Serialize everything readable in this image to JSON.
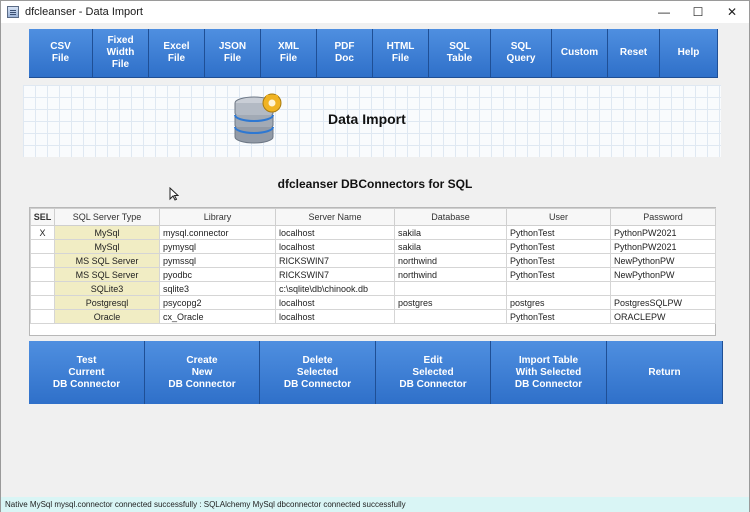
{
  "window": {
    "title": "dfcleanser - Data Import",
    "controls": {
      "minimize": "—",
      "maximize": "☐",
      "close": "✕"
    }
  },
  "toolbar": {
    "buttons": [
      "CSV\nFile",
      "Fixed\nWidth\nFile",
      "Excel\nFile",
      "JSON\nFile",
      "XML\nFile",
      "PDF\nDoc",
      "HTML\nFile",
      "SQL\nTable",
      "SQL\nQuery",
      "Custom",
      "Reset",
      "Help"
    ]
  },
  "banner": {
    "title": "Data Import",
    "logo_icon": "database-gear-icon"
  },
  "section": {
    "title": "dfcleanser DBConnectors for SQL"
  },
  "table": {
    "headers": [
      "SEL",
      "SQL Server Type",
      "Library",
      "Server Name",
      "Database",
      "User",
      "Password"
    ],
    "rows": [
      [
        "X",
        "MySql",
        "mysql.connector",
        "localhost",
        "sakila",
        "PythonTest",
        "PythonPW2021"
      ],
      [
        "",
        "MySql",
        "pymysql",
        "localhost",
        "sakila",
        "PythonTest",
        "PythonPW2021"
      ],
      [
        "",
        "MS SQL Server",
        "pymssql",
        "RICKSWIN7",
        "northwind",
        "PythonTest",
        "NewPythonPW"
      ],
      [
        "",
        "MS SQL Server",
        "pyodbc",
        "RICKSWIN7",
        "northwind",
        "PythonTest",
        "NewPythonPW"
      ],
      [
        "",
        "SQLite3",
        "sqlite3",
        "c:\\sqlite\\db\\chinook.db",
        "",
        "",
        ""
      ],
      [
        "",
        "Postgresql",
        "psycopg2",
        "localhost",
        "postgres",
        "postgres",
        "PostgresSQLPW"
      ],
      [
        "",
        "Oracle",
        "cx_Oracle",
        "localhost",
        "",
        "PythonTest",
        "ORACLEPW"
      ]
    ]
  },
  "actions": {
    "buttons": [
      "Test\nCurrent\nDB Connector",
      "Create\nNew\nDB Connector",
      "Delete\nSelected\nDB Connector",
      "Edit\nSelected\nDB Connector",
      "Import Table\nWith Selected\nDB Connector",
      "Return"
    ]
  },
  "status": {
    "text": "Native MySql mysql.connector connected successfully : SQLAlchemy MySql dbconnector connected successfully"
  },
  "colors": {
    "button_blue": "#2f70c9",
    "type_cell": "#f1edc4",
    "status_bg": "#d9f5f5"
  }
}
